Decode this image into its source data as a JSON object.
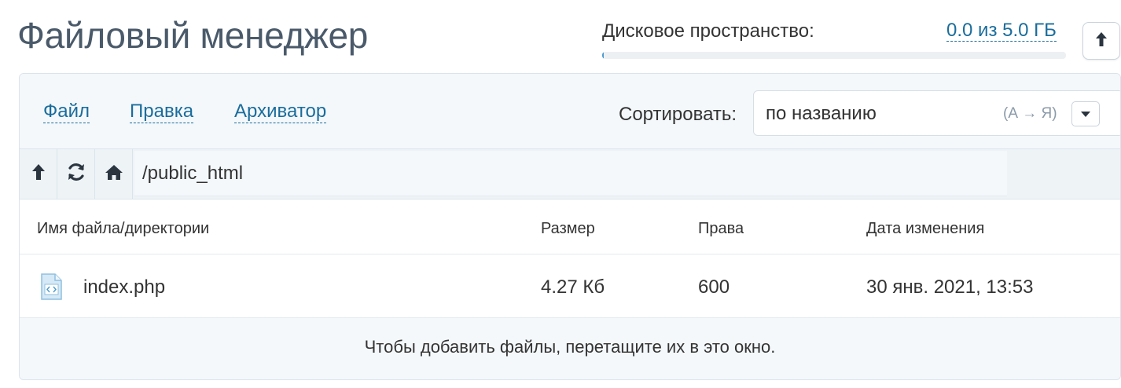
{
  "header": {
    "title": "Файловый менеджер",
    "disk_label": "Дисковое пространство:",
    "disk_value": "0.0 из 5.0 ГБ",
    "disk_used_fraction": 0.0034,
    "scroll_top_icon": "arrow-up-icon"
  },
  "menu": {
    "items": [
      "Файл",
      "Правка",
      "Архиватор"
    ],
    "sort_label": "Сортировать:",
    "sort_value": "по названию",
    "sort_hint": "(А → Я)"
  },
  "pathbar": {
    "path": "/public_html",
    "buttons": [
      "arrow-up-icon",
      "refresh-icon",
      "home-icon"
    ]
  },
  "table": {
    "columns": [
      "Имя файла/директории",
      "Размер",
      "Права",
      "Дата изменения"
    ],
    "rows": [
      {
        "name": "index.php",
        "size": "4.27 Кб",
        "perms": "600",
        "modified": "30 янв. 2021, 13:53",
        "icon": "code-file-icon"
      }
    ]
  },
  "drop_hint": "Чтобы добавить файлы, перетащите их в это окно.",
  "colors": {
    "link": "#1a6d9c",
    "title": "#4a5a6a",
    "panel_bg": "#f4f8fb",
    "border": "#dbe4ec"
  }
}
